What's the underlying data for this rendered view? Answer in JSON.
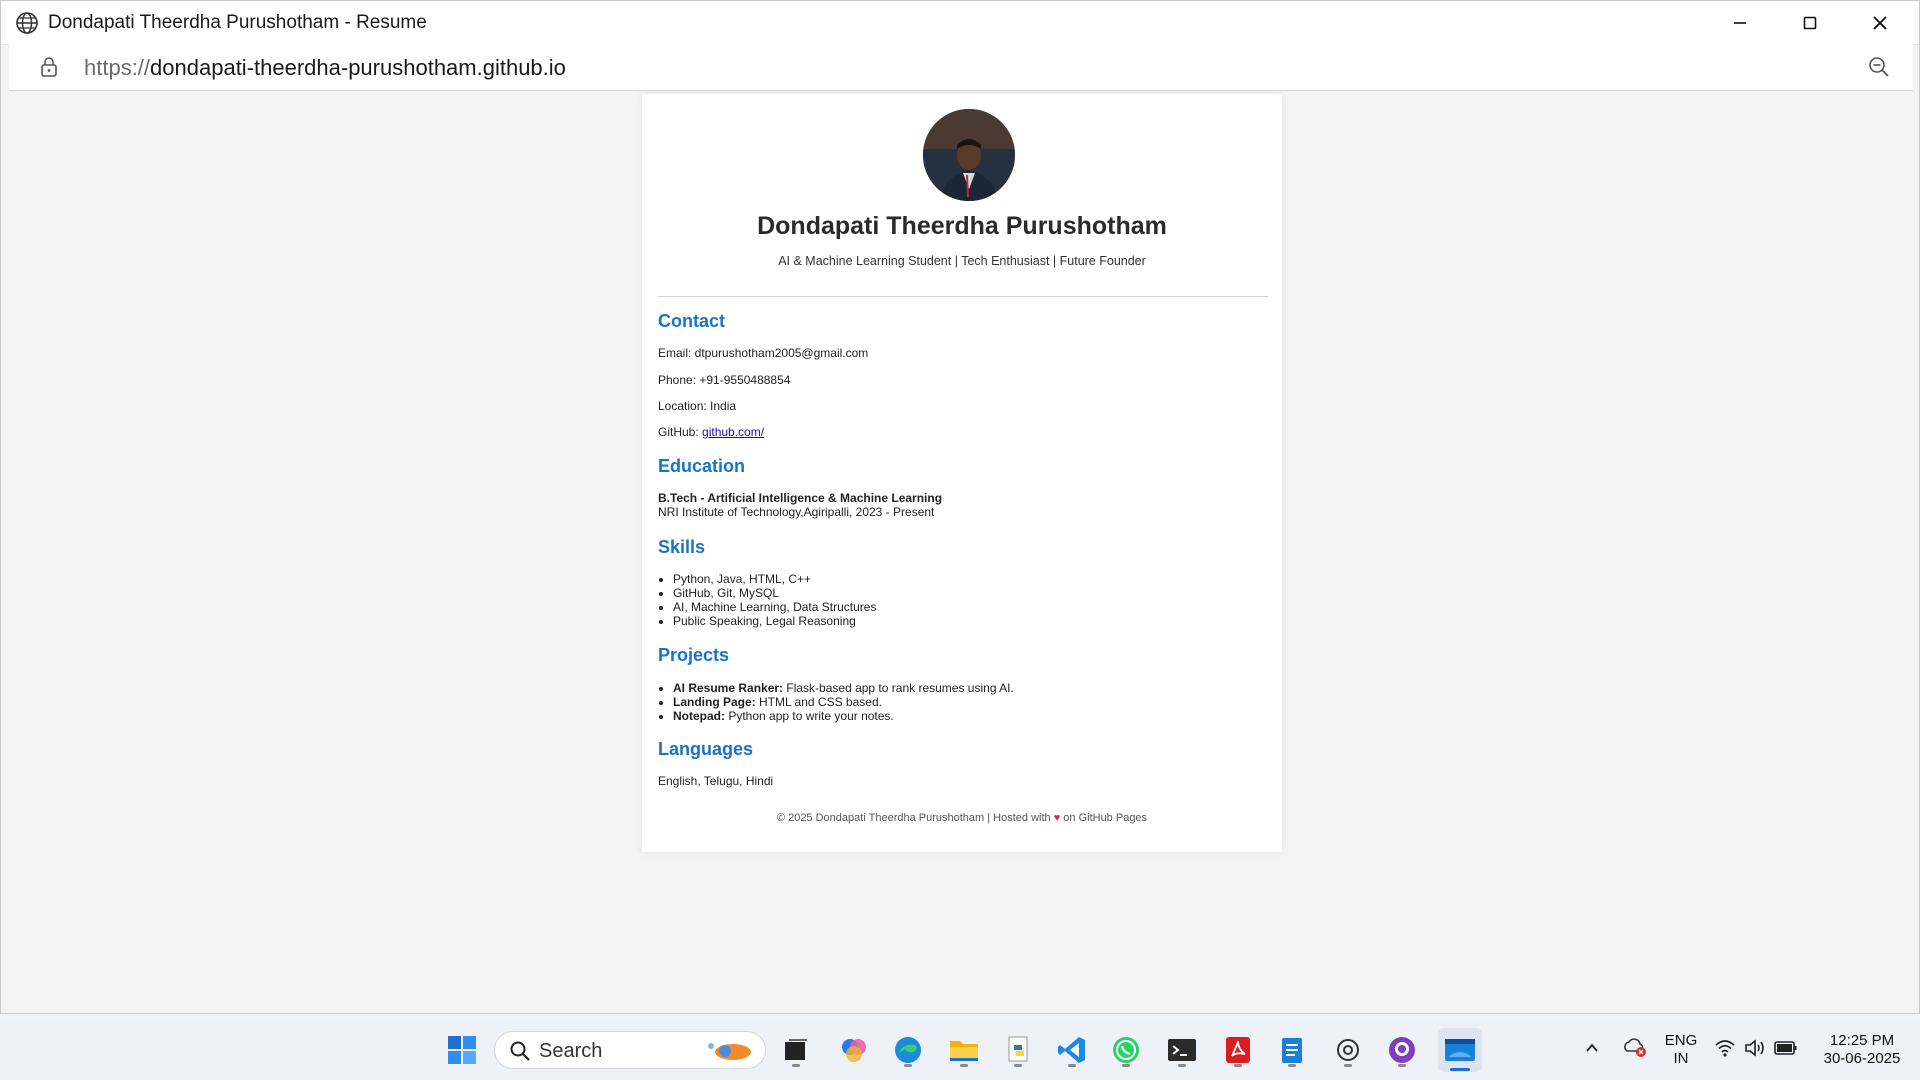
{
  "window": {
    "title": "Dondapati Theerdha Purushotham - Resume",
    "url_protocol": "https://",
    "url_domain": "dondapati-theerdha-purushotham.github.io"
  },
  "resume": {
    "name": "Dondapati Theerdha Purushotham",
    "tagline": "AI & Machine Learning Student | Tech Enthusiast | Future Founder",
    "contact": {
      "heading": "Contact",
      "email": "Email: dtpurushotham2005@gmail.com",
      "phone": "Phone: +91-9550488854",
      "location": "Location: India",
      "github_label": "GitHub: ",
      "github_link": "github.com/"
    },
    "education": {
      "heading": "Education",
      "degree": "B.Tech - Artificial Intelligence & Machine Learning",
      "institute": "NRI Institute of Technology,Agiripalli, 2023 - Present"
    },
    "skills": {
      "heading": "Skills",
      "items": [
        "Python, Java, HTML, C++",
        "GitHub, Git, MySQL",
        "AI, Machine Learning, Data Structures",
        "Public Speaking, Legal Reasoning"
      ]
    },
    "projects": {
      "heading": "Projects",
      "items": [
        {
          "title": "AI Resume Ranker:",
          "desc": " Flask-based app to rank resumes using AI."
        },
        {
          "title": "Landing Page:",
          "desc": " HTML and CSS based."
        },
        {
          "title": "Notepad:",
          "desc": " Python app to write your notes."
        }
      ]
    },
    "languages": {
      "heading": "Languages",
      "text": "English, Telugu, Hindi"
    },
    "footer": {
      "before": "© 2025 Dondapati Theerdha Purushotham | Hosted with ",
      "after": " on GitHub Pages"
    }
  },
  "taskbar": {
    "search_label": "Search",
    "lang_top": "ENG",
    "lang_bottom": "IN",
    "time": "12:25 PM",
    "date": "30-06-2025"
  },
  "colors": {
    "accent": "#1a73c4",
    "link": "#1a0dab",
    "heart": "#e0245e"
  }
}
